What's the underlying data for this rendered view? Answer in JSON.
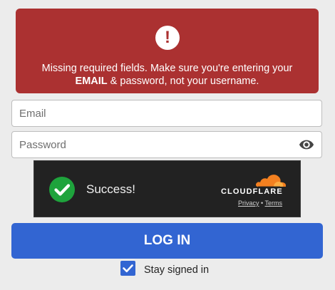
{
  "alert": {
    "icon": "exclamation-icon",
    "symbol": "!",
    "line1": "Missing required fields. Make sure you're entering your",
    "line2_bold": "EMAIL",
    "line2_rest": " & password, not your username.",
    "bg_color": "#ab3131"
  },
  "form": {
    "email_placeholder": "Email",
    "email_value": "",
    "password_placeholder": "Password",
    "password_value": "",
    "password_toggle_icon": "eye-icon"
  },
  "captcha": {
    "status_icon": "check-circle-icon",
    "status_text": "Success!",
    "brand": "CLOUDFLARE",
    "privacy_link": "Privacy",
    "separator": "•",
    "terms_link": "Terms"
  },
  "login_button": {
    "label": "LOG IN",
    "color": "#3265d2"
  },
  "stay_signed_in": {
    "label": "Stay signed in",
    "checked": true
  }
}
